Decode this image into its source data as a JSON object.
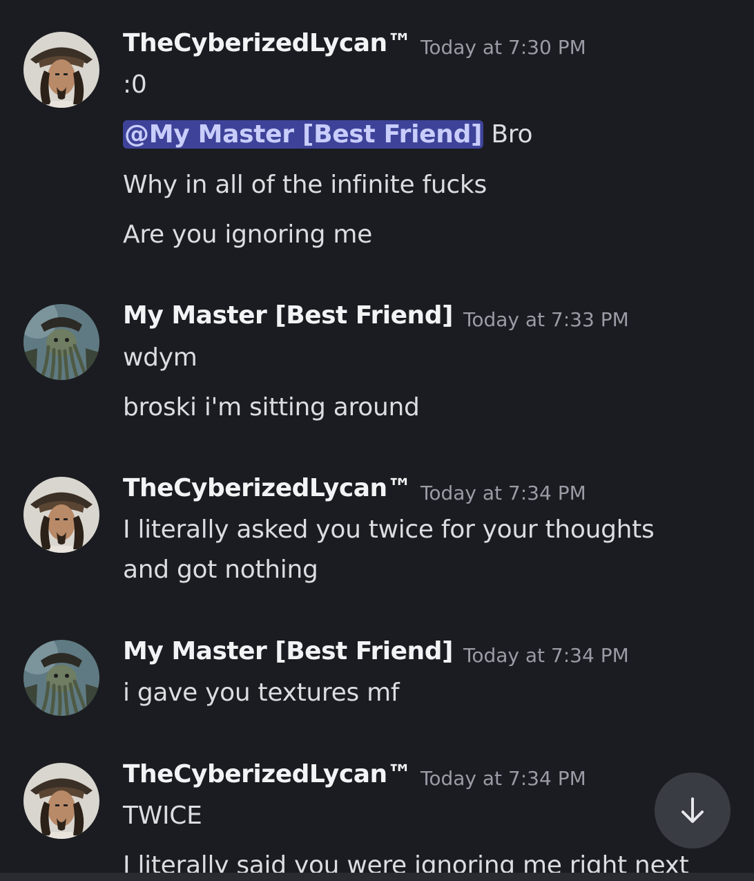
{
  "messages": [
    {
      "author": "TheCyberizedLycan™",
      "timestamp": "Today at 7:30 PM",
      "avatar": "pirate-captain-avatar",
      "lines": [
        ":0"
      ],
      "mention": "@My Master [Best Friend]",
      "mention_suffix": " Bro",
      "extra_lines": [
        "Why in all of the infinite fucks",
        "Are you ignoring me"
      ]
    },
    {
      "author": "My Master [Best Friend]",
      "timestamp": "Today at 7:33 PM",
      "avatar": "tentacle-captain-avatar",
      "lines": [
        "wdym",
        "broski i'm sitting around"
      ]
    },
    {
      "author": "TheCyberizedLycan™",
      "timestamp": "Today at 7:34 PM",
      "avatar": "pirate-captain-avatar",
      "lines": [
        "I literally asked you twice for your thoughts",
        "and got nothing"
      ]
    },
    {
      "author": "My Master [Best Friend]",
      "timestamp": "Today at 7:34 PM",
      "avatar": "tentacle-captain-avatar",
      "lines": [
        "i gave you textures mf"
      ]
    },
    {
      "author": "TheCyberizedLycan™",
      "timestamp": "Today at 7:34 PM",
      "avatar": "pirate-captain-avatar",
      "lines": [
        "TWICE",
        "I literally said you were ignoring me right next"
      ]
    }
  ],
  "scroll_button": {
    "icon": "arrow-down-icon"
  },
  "colors": {
    "background": "#1b1c21",
    "mention_bg": "#3e4399",
    "mention_text": "#c9cdfb",
    "timestamp": "#9a9ca6"
  }
}
